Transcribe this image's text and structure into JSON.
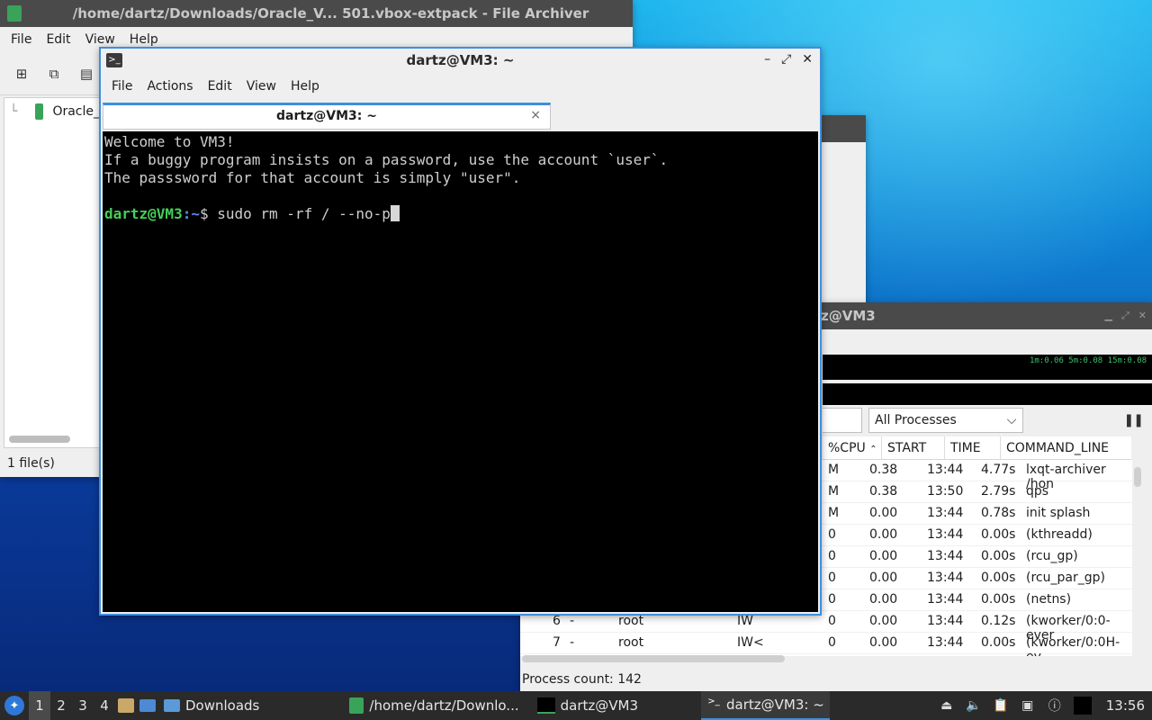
{
  "archiver": {
    "title": "/home/dartz/Downloads/Oracle_V... 501.vbox-extpack - File Archiver",
    "menu": [
      "File",
      "Edit",
      "View",
      "Help"
    ],
    "tree_item": "Oracle_",
    "status": "1 file(s)"
  },
  "terminal": {
    "title": "dartz@VM3: ~",
    "menu": [
      "File",
      "Actions",
      "Edit",
      "View",
      "Help"
    ],
    "tab_label": "dartz@VM3: ~",
    "close_tab": "×",
    "lines": [
      "Welcome to VM3!",
      "If a buggy program insists on a password, use the account `user`.",
      "The passsword for that account is simply \"user\"."
    ],
    "prompt_user": "dartz@VM3",
    "prompt_path": ":~",
    "prompt_symbol": "$ ",
    "command": "sudo rm -rf / --no-p",
    "controls": {
      "minimize": "–",
      "maximize": "⤢",
      "close": "✕"
    }
  },
  "process_viewer": {
    "title": "z@VM3",
    "load_text": "1m:0.06 5m:0.08 15m:0.08",
    "filter_selected": "All Processes",
    "headers": [
      "%CPU",
      "START",
      "TIME",
      "COMMAND_LINE"
    ],
    "rows": [
      {
        "pid": "",
        "tty": "",
        "user": "",
        "stat": "",
        "mem": "M",
        "cpu": "0.38",
        "start": "13:44",
        "time": "4.77s",
        "cmd": "lxqt-archiver /hon"
      },
      {
        "pid": "",
        "tty": "",
        "user": "",
        "stat": "",
        "mem": "M",
        "cpu": "0.38",
        "start": "13:50",
        "time": "2.79s",
        "cmd": "qps"
      },
      {
        "pid": "",
        "tty": "",
        "user": "",
        "stat": "",
        "mem": "M",
        "cpu": "0.00",
        "start": "13:44",
        "time": "0.78s",
        "cmd": "init splash"
      },
      {
        "pid": "",
        "tty": "",
        "user": "",
        "stat": "",
        "mem": "0",
        "cpu": "0.00",
        "start": "13:44",
        "time": "0.00s",
        "cmd": "(kthreadd)"
      },
      {
        "pid": "",
        "tty": "",
        "user": "",
        "stat": "",
        "mem": "0",
        "cpu": "0.00",
        "start": "13:44",
        "time": "0.00s",
        "cmd": "(rcu_gp)"
      },
      {
        "pid": "",
        "tty": "",
        "user": "",
        "stat": "",
        "mem": "0",
        "cpu": "0.00",
        "start": "13:44",
        "time": "0.00s",
        "cmd": "(rcu_par_gp)"
      },
      {
        "pid": "",
        "tty": "",
        "user": "",
        "stat": "",
        "mem": "0",
        "cpu": "0.00",
        "start": "13:44",
        "time": "0.00s",
        "cmd": "(netns)"
      },
      {
        "pid": "6",
        "tty": "-",
        "user": "root",
        "stat": "IW",
        "mem": "0",
        "cpu": "0.00",
        "start": "13:44",
        "time": "0.12s",
        "cmd": "(kworker/0:0-ever"
      },
      {
        "pid": "7",
        "tty": "-",
        "user": "root",
        "stat": "IW<",
        "mem": "0",
        "cpu": "0.00",
        "start": "13:44",
        "time": "0.00s",
        "cmd": "(kworker/0:0H-ev"
      }
    ],
    "status": "Process count: 142"
  },
  "taskbar": {
    "workspaces": [
      "1",
      "2",
      "3",
      "4"
    ],
    "downloads_label": "Downloads",
    "task_archiver": "/home/dartz/Downlo...",
    "task_vm3": "dartz@VM3",
    "task_term": "dartz@VM3: ~",
    "clock": "13:56"
  }
}
